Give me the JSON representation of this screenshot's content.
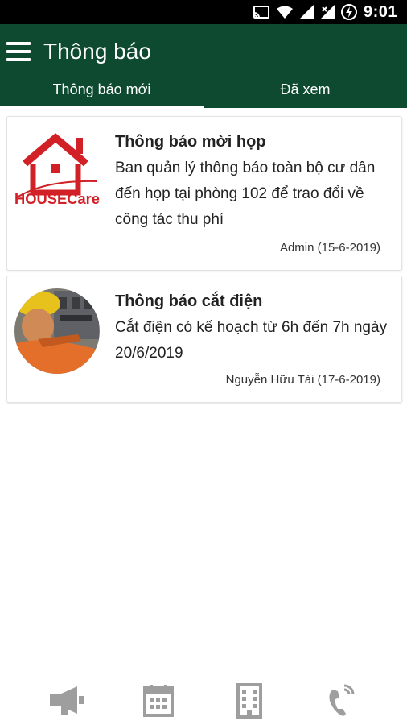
{
  "status_bar": {
    "time": "9:01",
    "icons": [
      "cast-icon",
      "wifi-icon",
      "signal-icon",
      "signal-x-icon",
      "battery-charging-icon"
    ]
  },
  "header": {
    "title": "Thông báo",
    "tabs": [
      {
        "label": "Thông báo mới",
        "active": true
      },
      {
        "label": "Đã xem",
        "active": false
      }
    ]
  },
  "notifications": [
    {
      "thumb": "housecare-logo",
      "logo_text": "HOUSECare",
      "title": "Thông báo mời họp",
      "body": "Ban quản lý thông báo toàn bộ cư dân đến họp tại phòng 102 để trao đổi về công tác thu phí",
      "meta": "Admin (15-6-2019)"
    },
    {
      "thumb": "electrician-photo",
      "title": "Thông báo cắt điện",
      "body": "Cắt điện có kế hoạch từ 6h đến 7h ngày 20/6/2019",
      "meta": "Nguyễn Hữu Tài (17-6-2019)"
    }
  ],
  "bottom_nav": {
    "items": [
      "megaphone-icon",
      "calendar-icon",
      "building-icon",
      "phone-ringing-icon"
    ]
  },
  "colors": {
    "app_bar": "#0d4a30",
    "nav_icon": "#9e9e9e",
    "logo_red": "#d22027"
  }
}
